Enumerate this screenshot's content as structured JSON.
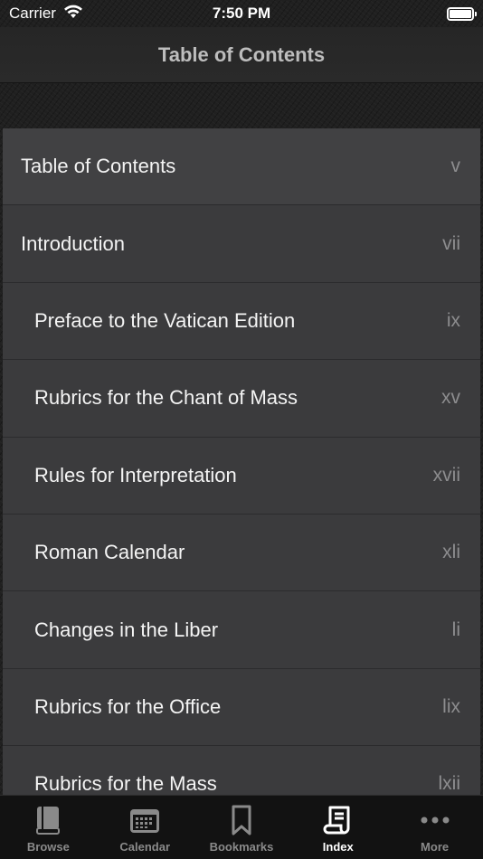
{
  "status_bar": {
    "carrier": "Carrier",
    "time": "7:50 PM"
  },
  "nav": {
    "title": "Table of Contents"
  },
  "toc": {
    "items": [
      {
        "title": "Table of Contents",
        "page": "v"
      },
      {
        "title": "Introduction",
        "page": "vii"
      },
      {
        "title": "Preface to the Vatican Edition",
        "page": "ix"
      },
      {
        "title": "Rubrics for the Chant of Mass",
        "page": "xv"
      },
      {
        "title": "Rules for Interpretation",
        "page": "xvii"
      },
      {
        "title": "Roman Calendar",
        "page": "xli"
      },
      {
        "title": "Changes in the Liber",
        "page": "li"
      },
      {
        "title": "Rubrics for the Office",
        "page": "lix"
      },
      {
        "title": "Rubrics for the Mass",
        "page": "lxii"
      }
    ]
  },
  "tabs": [
    {
      "label": "Browse",
      "icon": "book-icon"
    },
    {
      "label": "Calendar",
      "icon": "calendar-icon"
    },
    {
      "label": "Bookmarks",
      "icon": "bookmark-icon"
    },
    {
      "label": "Index",
      "icon": "scroll-icon",
      "active": true
    },
    {
      "label": "More",
      "icon": "more-icon"
    }
  ],
  "colors": {
    "tab_active": "#ffffff",
    "tab_inactive": "#8a8a8a",
    "row_bg": "#3b3b3d"
  }
}
